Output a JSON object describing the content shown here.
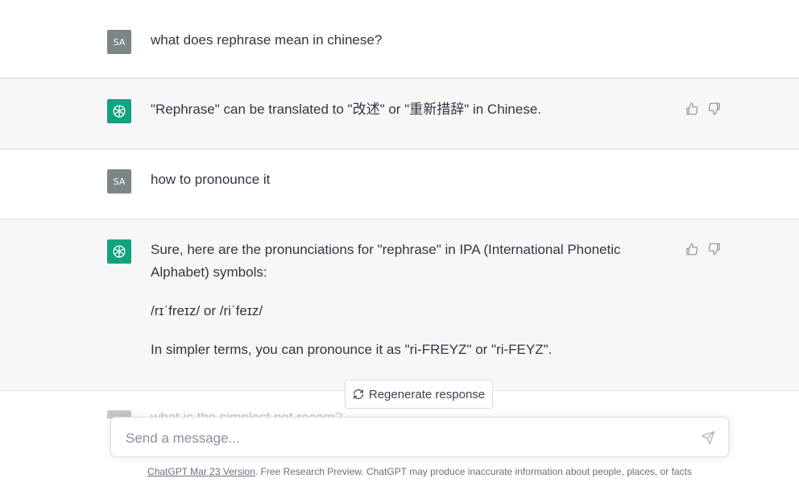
{
  "messages": [
    {
      "role": "user",
      "avatar": "SA",
      "paragraphs": [
        "what does  rephrase mean in chinese?"
      ]
    },
    {
      "role": "assistant",
      "avatar_icon": "openai-logo-icon",
      "paragraphs": [
        "\"Rephrase\" can be translated to \"改述\" or \"重新措辞\" in Chinese."
      ]
    },
    {
      "role": "user",
      "avatar": "SA",
      "paragraphs": [
        "how to pronounce it"
      ]
    },
    {
      "role": "assistant",
      "avatar_icon": "openai-logo-icon",
      "paragraphs": [
        "Sure, here are the pronunciations for \"rephrase\" in IPA (International Phonetic Alphabet) symbols:",
        "/rɪˈfreɪz/ or /riˈfeɪz/",
        "In simpler terms, you can pronounce it as \"ri-FREYZ\" or \"ri-FEYZ\"."
      ]
    }
  ],
  "next_message_preview": "what is the simplest not recom?",
  "regenerate": {
    "label": "Regenerate response",
    "icon": "refresh-icon"
  },
  "composer": {
    "placeholder": "Send a message...",
    "value": "",
    "send_icon": "send-icon"
  },
  "footer": {
    "version_link": "ChatGPT Mar 23 Version",
    "disclaimer": ". Free Research Preview. ChatGPT may produce inaccurate information about people, places, or facts"
  },
  "colors": {
    "assistant_bg": "#f7f7f8",
    "user_avatar": "#7d8587",
    "bot_avatar": "#10a37f",
    "border": "#e5e5e5"
  }
}
